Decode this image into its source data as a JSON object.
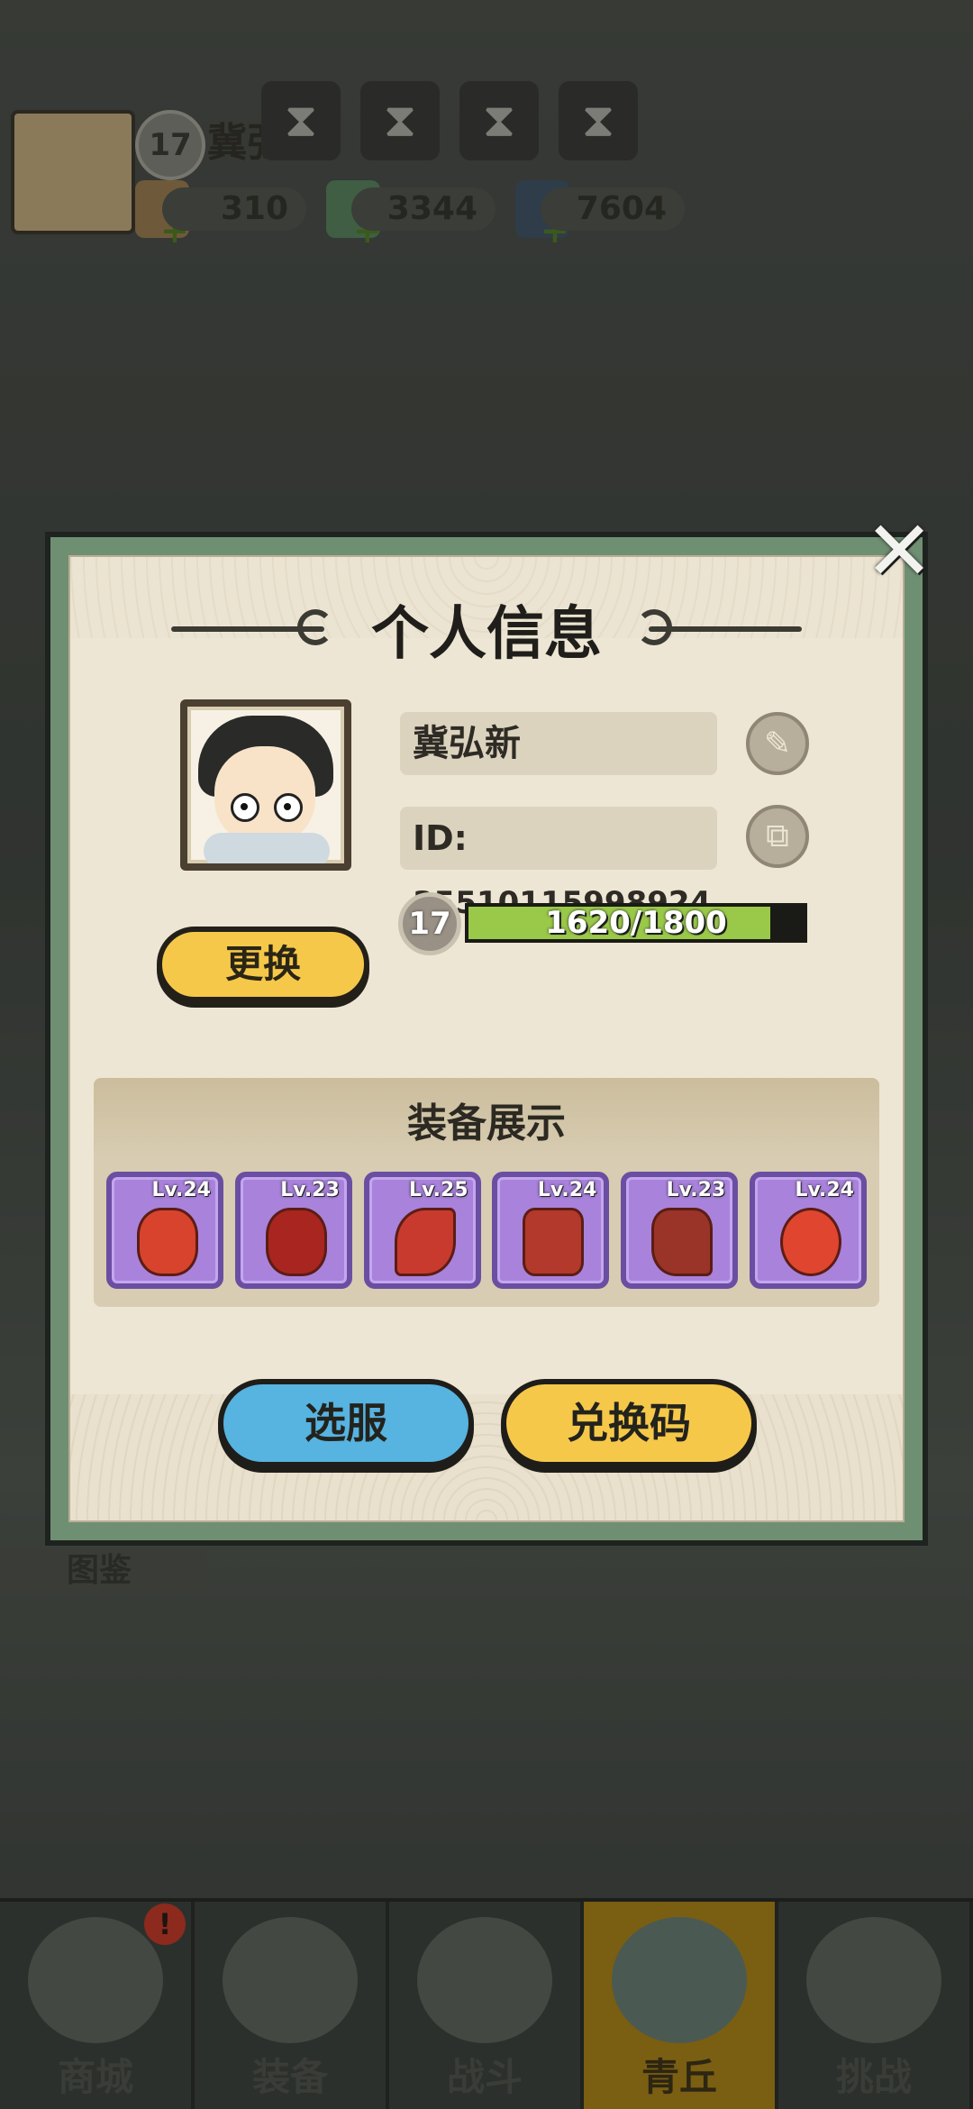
{
  "hud": {
    "level": "17",
    "player_name": "冀弘新",
    "speed_icons": [
      "hourglass-icon",
      "hourglass-icon",
      "hourglass-icon",
      "hourglass-icon"
    ],
    "resources": [
      {
        "icon": "scroll-currency-icon",
        "value": "310"
      },
      {
        "icon": "jade-dragon-icon",
        "value": "3344"
      },
      {
        "icon": "crystal-icon",
        "value": "7604"
      }
    ]
  },
  "dialog": {
    "title": "个人信息",
    "name": "冀弘新",
    "id_label": "ID:",
    "id_value": "35510115998924",
    "level": "17",
    "xp_text": "1620/1800",
    "xp_fraction": 0.9,
    "change_button": "更换",
    "equip_title": "装备展示",
    "equipment": [
      {
        "level": "Lv.24",
        "icon": "flame-ornament-icon"
      },
      {
        "level": "Lv.23",
        "icon": "demon-helmet-icon"
      },
      {
        "level": "Lv.25",
        "icon": "flame-blade-icon"
      },
      {
        "level": "Lv.24",
        "icon": "armor-chest-icon"
      },
      {
        "level": "Lv.23",
        "icon": "boots-icon"
      },
      {
        "level": "Lv.24",
        "icon": "lotus-orb-icon"
      }
    ],
    "server_button": "选服",
    "redeem_button": "兑换码",
    "close_icon": "close-icon"
  },
  "side": {
    "atlas_label": "图鉴"
  },
  "nav": {
    "items": [
      {
        "label": "商城",
        "badge": "!"
      },
      {
        "label": "装备"
      },
      {
        "label": "战斗"
      },
      {
        "label": "青丘",
        "active": true
      },
      {
        "label": "挑战"
      }
    ]
  },
  "colors": {
    "dialog_border": "#6f8f73",
    "paper": "#eee6d4",
    "xp_fill": "#9ac94a",
    "slot_purple": "#a982dc",
    "button_yellow": "#f6c84a",
    "button_blue": "#57b3e0",
    "nav_active": "#7a5e12"
  }
}
